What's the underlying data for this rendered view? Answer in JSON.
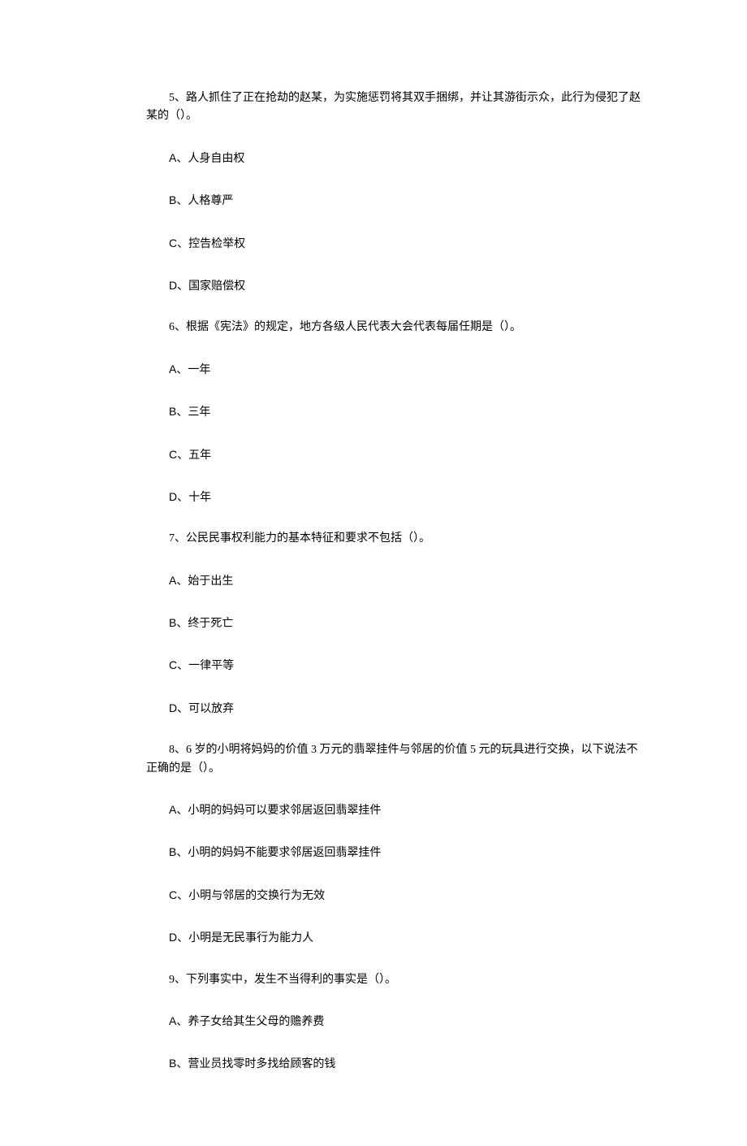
{
  "questions": [
    {
      "number": "5、",
      "text": "路人抓住了正在抢劫的赵某，为实施惩罚将其双手捆绑，并让其游街示众，此行为侵犯了赵某的（）。",
      "continued": true,
      "options": [
        {
          "letter": "A",
          "text": "人身自由权"
        },
        {
          "letter": "B",
          "text": "人格尊严"
        },
        {
          "letter": "C",
          "text": "控告检举权"
        },
        {
          "letter": "D",
          "text": "国家赔偿权"
        }
      ]
    },
    {
      "number": "6、",
      "text": "根据《宪法》的规定，地方各级人民代表大会代表每届任期是（）。",
      "continued": false,
      "options": [
        {
          "letter": "A",
          "text": "一年"
        },
        {
          "letter": "B",
          "text": "三年"
        },
        {
          "letter": "C",
          "text": "五年"
        },
        {
          "letter": "D",
          "text": "十年"
        }
      ]
    },
    {
      "number": "7、",
      "text": "公民民事权利能力的基本特征和要求不包括（）。",
      "continued": false,
      "options": [
        {
          "letter": "A",
          "text": "始于出生"
        },
        {
          "letter": "B",
          "text": "终于死亡"
        },
        {
          "letter": "C",
          "text": "一律平等"
        },
        {
          "letter": "D",
          "text": "可以放弃"
        }
      ]
    },
    {
      "number": "8、",
      "text": "6 岁的小明将妈妈的价值 3 万元的翡翠挂件与邻居的价值 5 元的玩具进行交换，以下说法不正确的是（）。",
      "continued": true,
      "options": [
        {
          "letter": "A",
          "text": "小明的妈妈可以要求邻居返回翡翠挂件"
        },
        {
          "letter": "B",
          "text": "小明的妈妈不能要求邻居返回翡翠挂件"
        },
        {
          "letter": "C",
          "text": "小明与邻居的交换行为无效"
        },
        {
          "letter": "D",
          "text": "小明是无民事行为能力人"
        }
      ]
    },
    {
      "number": "9、",
      "text": "下列事实中，发生不当得利的事实是（）。",
      "continued": false,
      "options": [
        {
          "letter": "A",
          "text": "养子女给其生父母的赡养费"
        },
        {
          "letter": "B",
          "text": "营业员找零时多找给顾客的钱"
        }
      ]
    }
  ]
}
